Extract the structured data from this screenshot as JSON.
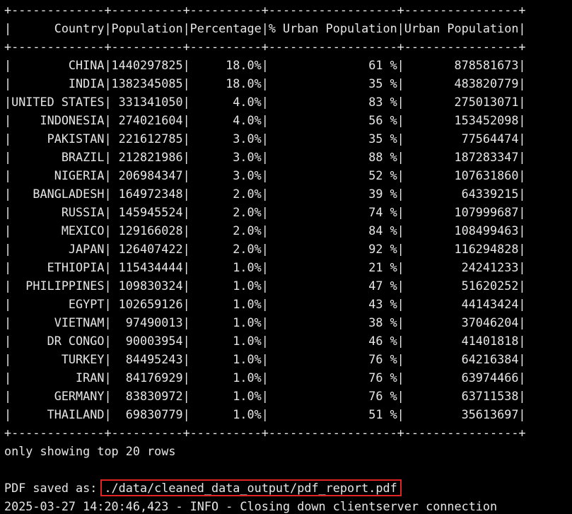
{
  "terminal": {
    "border": "+-------------+----------+----------+------------------+----------------+",
    "header": "|      Country|Population|Percentage|% Urban Population|Urban Population|",
    "rows": [
      "|        CHINA|1440297825|     18.0%|              61 %|       878581673|",
      "|        INDIA|1382345085|     18.0%|              35 %|       483820779|",
      "|UNITED STATES| 331341050|      4.0%|              83 %|       275013071|",
      "|    INDONESIA| 274021604|      4.0%|              56 %|       153452098|",
      "|     PAKISTAN| 221612785|      3.0%|              35 %|        77564474|",
      "|       BRAZIL| 212821986|      3.0%|              88 %|       187283347|",
      "|      NIGERIA| 206984347|      3.0%|              52 %|       107631860|",
      "|   BANGLADESH| 164972348|      2.0%|              39 %|        64339215|",
      "|       RUSSIA| 145945524|      2.0%|              74 %|       107999687|",
      "|       MEXICO| 129166028|      2.0%|              84 %|       108499463|",
      "|        JAPAN| 126407422|      2.0%|              92 %|       116294828|",
      "|     ETHIOPIA| 115434444|      1.0%|              21 %|        24241233|",
      "|  PHILIPPINES| 109830324|      1.0%|              47 %|        51620252|",
      "|        EGYPT| 102659126|      1.0%|              43 %|        44143424|",
      "|      VIETNAM|  97490013|      1.0%|              38 %|        37046204|",
      "|     DR CONGO|  90003954|      1.0%|              46 %|        41401818|",
      "|       TURKEY|  84495243|      1.0%|              76 %|        64216384|",
      "|         IRAN|  84176929|      1.0%|              76 %|        63974466|",
      "|      GERMANY|  83830972|      1.0%|              76 %|        63711538|",
      "|     THAILAND|  69830779|      1.0%|              51 %|        35613697|"
    ],
    "footer_note": "only showing top 20 rows",
    "pdf_label": "PDF saved as: ",
    "pdf_path": "./data/cleaned_data_output/pdf_report.pdf",
    "log_line": "2025-03-27 14:20:46,423 - INFO - Closing down clientserver connection"
  },
  "colors": {
    "background": "#000000",
    "text": "#e6e6e6",
    "highlight_box": "#e02424"
  }
}
